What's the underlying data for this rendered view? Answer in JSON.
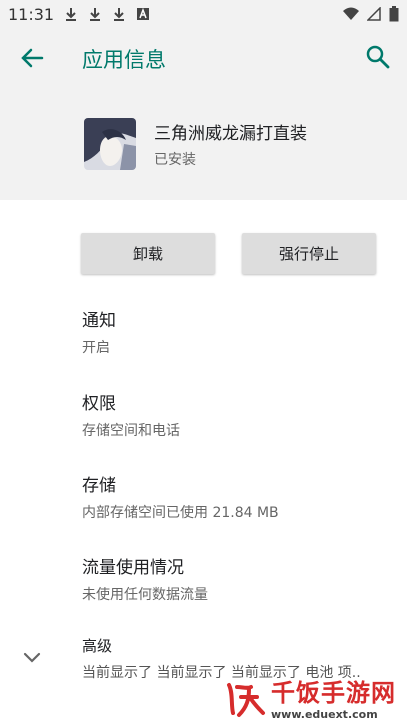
{
  "status_bar": {
    "time": "11:31"
  },
  "toolbar": {
    "title": "应用信息"
  },
  "app": {
    "name": "三角洲威龙漏打直装",
    "status": "已安装"
  },
  "buttons": {
    "uninstall": "卸载",
    "force_stop": "强行停止"
  },
  "prefs": [
    {
      "title": "通知",
      "summary": "开启"
    },
    {
      "title": "权限",
      "summary": "存储空间和电话"
    },
    {
      "title": "存储",
      "summary": "内部存储空间已使用 21.84 MB"
    },
    {
      "title": "流量使用情况",
      "summary": "未使用任何数据流量"
    },
    {
      "title": "高级",
      "summary": "当前显示了 当前显示了 当前显示了 电池 项.."
    }
  ],
  "watermark": {
    "text": "千饭手游网",
    "url": "www.eduext.com"
  },
  "colors": {
    "accent": "#00796b",
    "header_bg": "#f2f2f2",
    "button_bg": "#dddddd",
    "watermark": "#d62c2c"
  }
}
